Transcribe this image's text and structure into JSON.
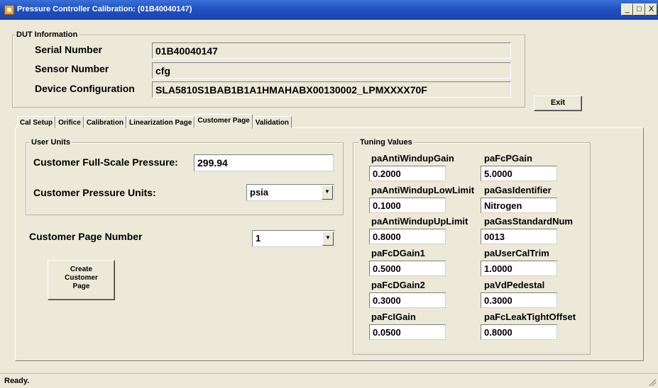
{
  "window": {
    "title": "Pressure Controller Calibration: (01B40040147)",
    "controls": {
      "minimize": "_",
      "maximize": "□",
      "close": "X"
    }
  },
  "dut": {
    "group_label": "DUT Information",
    "serial_label": "Serial Number",
    "serial_value": "01B40040147",
    "sensor_label": "Sensor Number",
    "sensor_value": "cfg",
    "config_label": "Device Configuration",
    "config_value": "SLA5810S1BAB1B1A1HMAHABX00130002_LPMXXXX70F"
  },
  "exit_label": "Exit",
  "tabs": [
    "Cal Setup",
    "Orifice",
    "Calibration",
    "Linearization Page",
    "Customer Page",
    "Validation"
  ],
  "active_tab": "Customer Page",
  "user_units": {
    "group_label": "User Units",
    "fullscale_label": "Customer Full-Scale Pressure:",
    "fullscale_value": "299.94",
    "units_label": "Customer Pressure Units:",
    "units_value": "psia"
  },
  "page_number": {
    "label": "Customer Page Number",
    "value": "1"
  },
  "create_button_label": "Create\nCustomer\nPage",
  "tuning": {
    "group_label": "Tuning Values",
    "fields": [
      {
        "label": "paAntiWindupGain",
        "value": "0.2000"
      },
      {
        "label": "paFcPGain",
        "value": "5.0000"
      },
      {
        "label": "paAntiWindupLowLimit",
        "value": "0.1000"
      },
      {
        "label": "paGasIdentifier",
        "value": "Nitrogen"
      },
      {
        "label": "paAntiWindupUpLimit",
        "value": "0.8000"
      },
      {
        "label": "paGasStandardNum",
        "value": "0013"
      },
      {
        "label": "paFcDGain1",
        "value": "0.5000"
      },
      {
        "label": "paUserCalTrim",
        "value": "1.0000"
      },
      {
        "label": "paFcDGain2",
        "value": "0.3000"
      },
      {
        "label": "paVdPedestal",
        "value": "0.3000"
      },
      {
        "label": "paFcIGain",
        "value": "0.0500"
      },
      {
        "label": "paFcLeakTightOffset",
        "value": "0.8000"
      }
    ]
  },
  "status": "Ready."
}
